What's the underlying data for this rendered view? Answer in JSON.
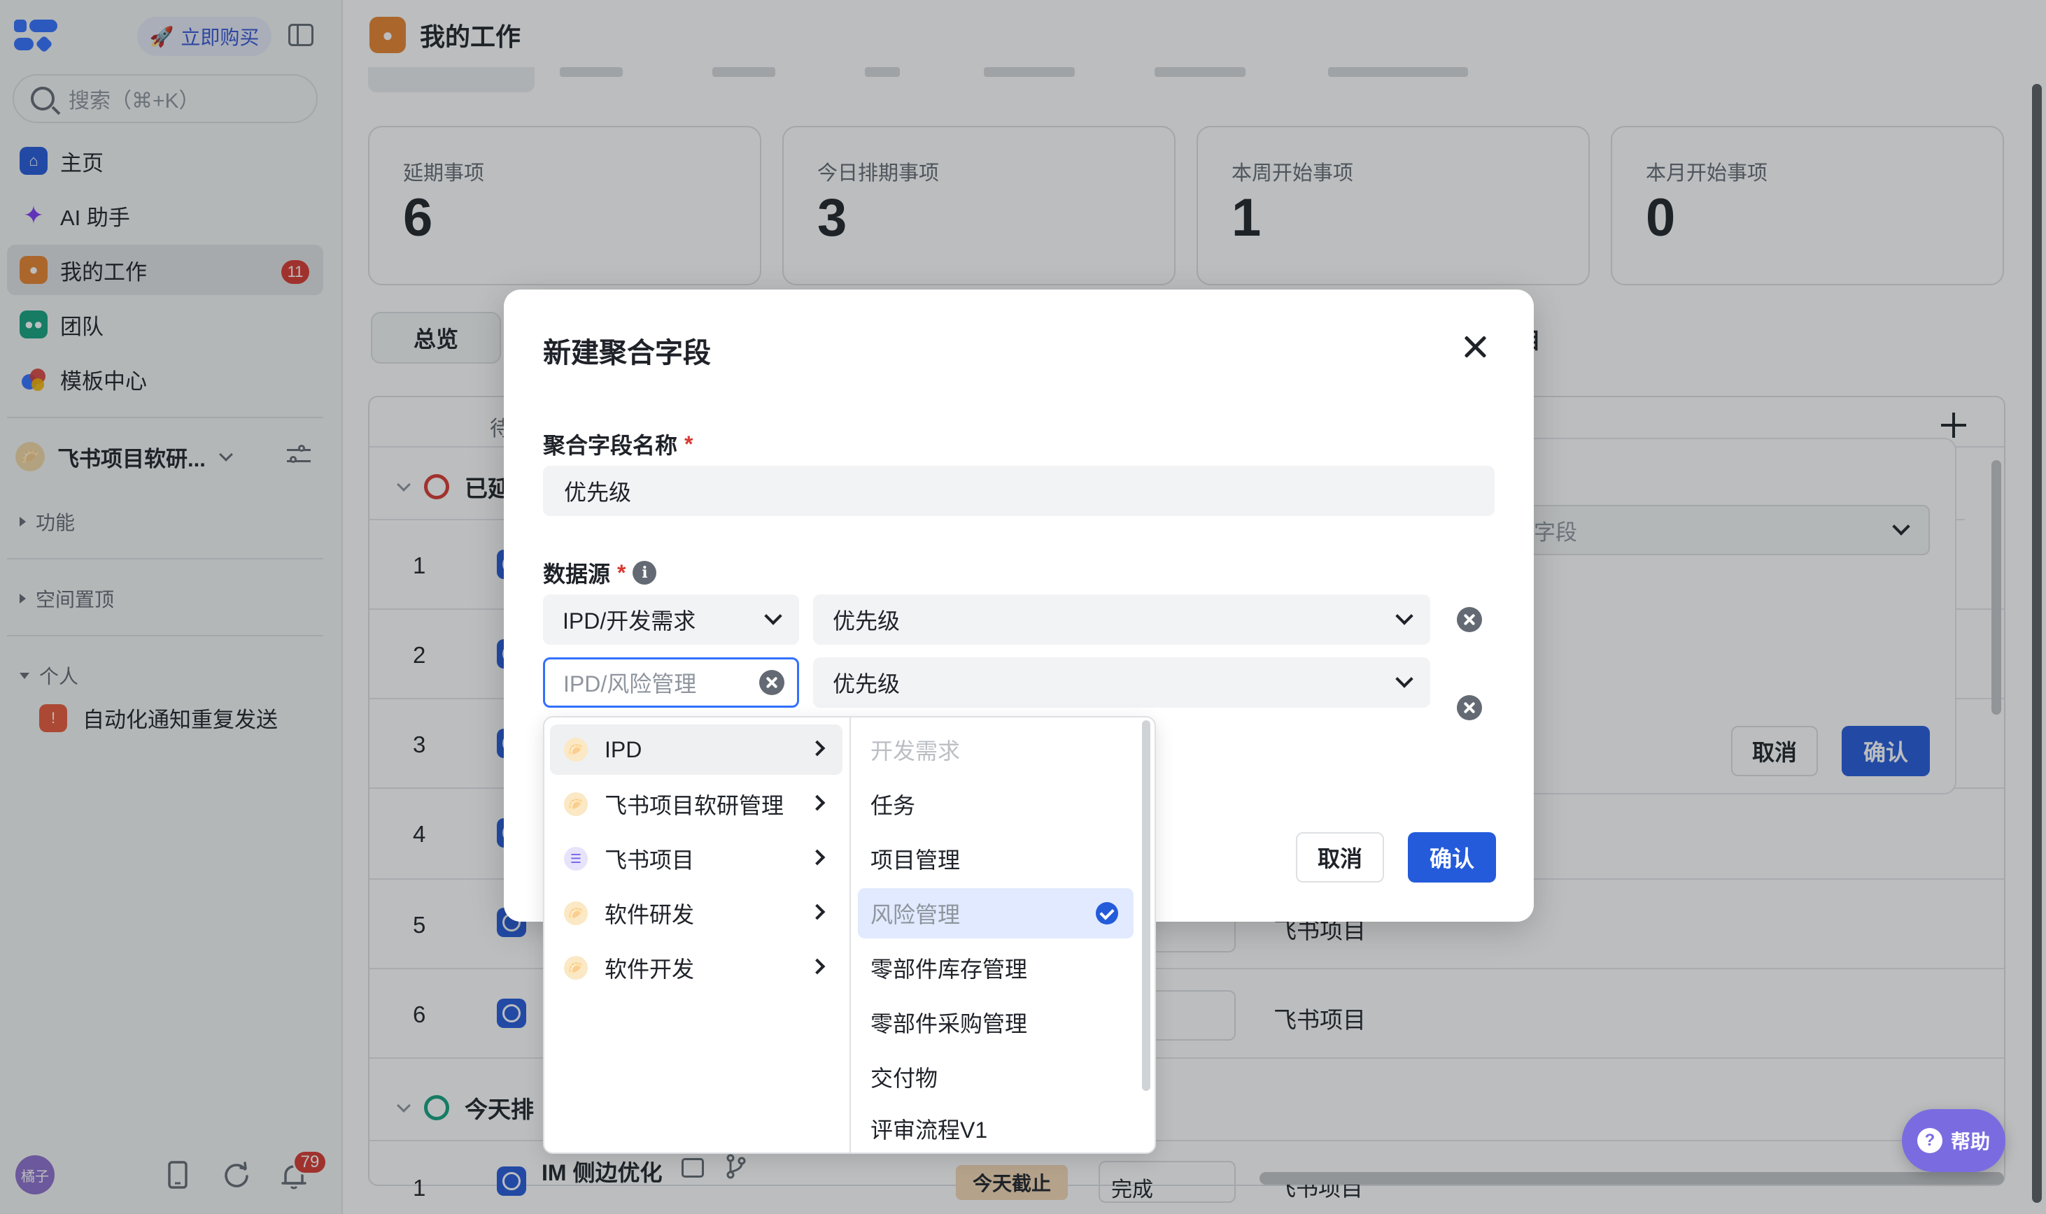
{
  "sidebar": {
    "buy_label": "立即购买",
    "search_placeholder": "搜索（⌘+K）",
    "nav": [
      {
        "label": "主页",
        "color": "#245bdb"
      },
      {
        "label": "AI 助手",
        "color": "#7f3bf5"
      },
      {
        "label": "我的工作",
        "color": "#e8832e",
        "badge": "11"
      },
      {
        "label": "团队",
        "color": "#14a37f"
      },
      {
        "label": "模板中心",
        "color": "#d83931"
      }
    ],
    "space_name": "飞书项目软研...",
    "sections": {
      "features": "功能",
      "pinned": "空间置顶",
      "personal": "个人"
    },
    "personal_items": [
      "自动化通知重复发送"
    ],
    "user_initials": "橘子",
    "notification_count": "79"
  },
  "page": {
    "title": "我的工作",
    "stats": [
      {
        "label": "延期事项",
        "value": "6"
      },
      {
        "label": "今日排期事项",
        "value": "3"
      },
      {
        "label": "本周开始事项",
        "value": "1"
      },
      {
        "label": "本月开始事项",
        "value": "0"
      }
    ],
    "overview_tab": "总览",
    "partial_tab": "目",
    "column_header_partial": "待",
    "groups": [
      {
        "label": "已延",
        "color": "#d83931"
      },
      {
        "label": "今天排",
        "color": "#14a37f"
      }
    ],
    "row_numbers": [
      "1",
      "2",
      "3",
      "4",
      "5",
      "6"
    ],
    "row_projects": [
      "飞书项目",
      "飞书项目"
    ],
    "today_row": {
      "number": "1",
      "title": "IM 侧边优化",
      "status": "今天截止",
      "state": "完成",
      "project": "飞书项目"
    },
    "side_panel": {
      "select_placeholder": "字段",
      "cancel": "取消",
      "confirm": "确认"
    }
  },
  "modal": {
    "title": "新建聚合字段",
    "name_label": "聚合字段名称",
    "name_value": "优先级",
    "source_label": "数据源",
    "rows": [
      {
        "source": "IPD/开发需求",
        "field": "优先级"
      },
      {
        "source_placeholder": "IPD/风险管理",
        "field": "优先级"
      }
    ],
    "cancel": "取消",
    "confirm": "确认"
  },
  "cascader": {
    "workspaces": [
      {
        "label": "IPD",
        "icon": "🥟"
      },
      {
        "label": "飞书项目软研管理",
        "icon": "🥟"
      },
      {
        "label": "飞书项目",
        "icon": "☰"
      },
      {
        "label": "软件研发",
        "icon": "🥟"
      },
      {
        "label": "软件开发",
        "icon": "🥟"
      }
    ],
    "work_item_types": [
      {
        "label": "开发需求",
        "state": "disabled"
      },
      {
        "label": "任务",
        "state": "normal"
      },
      {
        "label": "项目管理",
        "state": "normal"
      },
      {
        "label": "风险管理",
        "state": "selected"
      },
      {
        "label": "零部件库存管理",
        "state": "normal"
      },
      {
        "label": "零部件采购管理",
        "state": "normal"
      },
      {
        "label": "交付物",
        "state": "normal"
      },
      {
        "label": "评审流程V1",
        "state": "normal"
      }
    ]
  },
  "help_label": "帮助"
}
